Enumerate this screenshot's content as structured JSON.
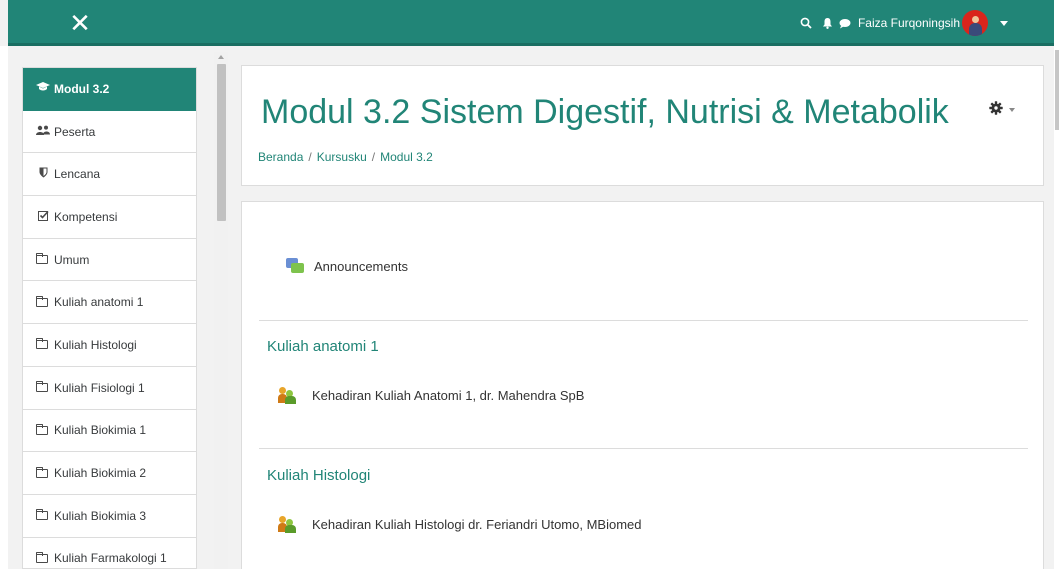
{
  "navbar": {
    "close_glyph": "✕",
    "search_icon": "search-icon",
    "notification_icon": "bell-icon",
    "messages_icon": "chat-bubble-icon",
    "username": "Faiza Furqoningsih",
    "colors": {
      "brand": "#218577"
    }
  },
  "drawer": {
    "items": [
      {
        "label": "Modul 3.2",
        "icon": "graduation-cap-icon",
        "active": true
      },
      {
        "label": "Peserta",
        "icon": "users-icon"
      },
      {
        "label": "Lencana",
        "icon": "shield-icon"
      },
      {
        "label": "Kompetensi",
        "icon": "checkbox-icon"
      },
      {
        "label": "Umum",
        "icon": "folder-icon"
      },
      {
        "label": "Kuliah anatomi 1",
        "icon": "folder-icon"
      },
      {
        "label": "Kuliah Histologi",
        "icon": "folder-icon"
      },
      {
        "label": "Kuliah Fisiologi 1",
        "icon": "folder-icon"
      },
      {
        "label": "Kuliah Biokimia 1",
        "icon": "folder-icon"
      },
      {
        "label": "Kuliah Biokimia 2",
        "icon": "folder-icon"
      },
      {
        "label": "Kuliah Biokimia 3",
        "icon": "folder-icon"
      },
      {
        "label": "Kuliah Farmakologi 1",
        "icon": "folder-icon"
      }
    ]
  },
  "header": {
    "title": "Modul 3.2 Sistem Digestif, Nutrisi & Metabolik",
    "breadcrumb": [
      "Beranda",
      "Kursusku",
      "Modul 3.2"
    ],
    "breadcrumb_separator": "/"
  },
  "content": {
    "general_activities": [
      {
        "label": "Announcements",
        "icon": "forum-icon"
      }
    ],
    "sections": [
      {
        "title": "Kuliah anatomi 1",
        "activities": [
          {
            "label": "Kehadiran Kuliah Anatomi 1, dr. Mahendra SpB",
            "icon": "attendance-icon"
          }
        ]
      },
      {
        "title": "Kuliah Histologi",
        "activities": [
          {
            "label": "Kehadiran Kuliah Histologi dr. Feriandri Utomo, MBiomed",
            "icon": "attendance-icon"
          }
        ]
      }
    ]
  }
}
